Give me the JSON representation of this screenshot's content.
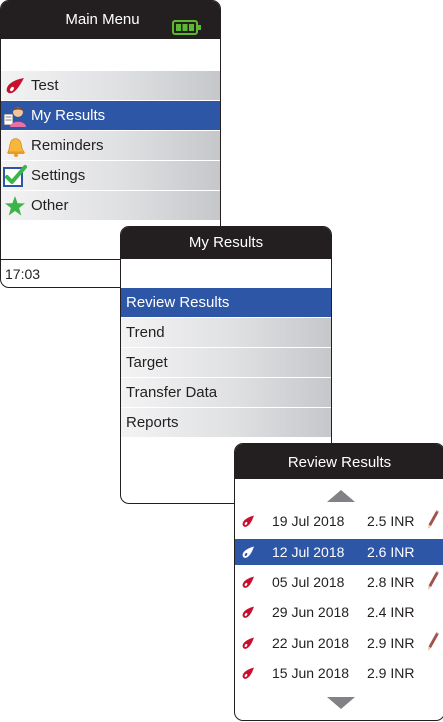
{
  "main_menu": {
    "title": "Main Menu",
    "battery_icon": "battery-full-icon",
    "items": [
      {
        "label": "Test",
        "icon": "blood-drop-icon"
      },
      {
        "label": "My Results",
        "icon": "user-results-icon",
        "selected": true
      },
      {
        "label": "Reminders",
        "icon": "bell-icon"
      },
      {
        "label": "Settings",
        "icon": "checkbox-checked-icon"
      },
      {
        "label": "Other",
        "icon": "star-icon"
      }
    ],
    "time": "17:03"
  },
  "my_results": {
    "title": "My Results",
    "items": [
      {
        "label": "Review Results",
        "selected": true
      },
      {
        "label": "Trend"
      },
      {
        "label": "Target"
      },
      {
        "label": "Transfer Data"
      },
      {
        "label": "Reports"
      }
    ]
  },
  "review_results": {
    "title": "Review Results",
    "rows": [
      {
        "date": "19 Jul 2018",
        "value": "2.5 INR",
        "note": true
      },
      {
        "date": "12 Jul 2018",
        "value": "2.6 INR",
        "note": false,
        "selected": true
      },
      {
        "date": "05 Jul 2018",
        "value": "2.8 INR",
        "note": true
      },
      {
        "date": "29 Jun 2018",
        "value": "2.4 INR",
        "note": false
      },
      {
        "date": "22 Jun 2018",
        "value": "2.9 INR",
        "note": true
      },
      {
        "date": "15 Jun 2018",
        "value": "2.9 INR",
        "note": false
      }
    ]
  },
  "colors": {
    "title_bar": "#231f20",
    "selection": "#2e56a6",
    "drop": "#c8102e",
    "battery": "#5cb82e"
  }
}
